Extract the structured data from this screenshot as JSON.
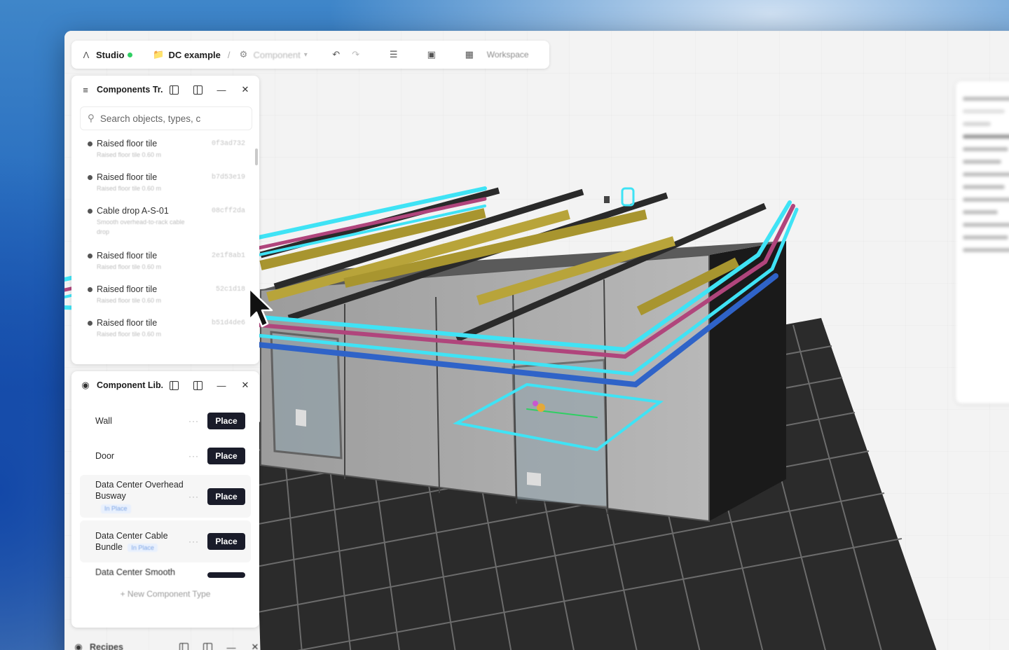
{
  "toolbar": {
    "app_name": "Studio",
    "project": "DC example",
    "component_menu": "Component",
    "workspace": "Workspace",
    "status_color": "#2fcf63"
  },
  "tree_panel": {
    "title": "Components Tr...",
    "search_placeholder": "Search objects, types, c",
    "items": [
      {
        "name": "Raised floor tile",
        "sub": "Raised floor tile 0.60 m",
        "id": "0f3ad732"
      },
      {
        "name": "Raised floor tile",
        "sub": "Raised floor tile 0.60 m",
        "id": "b7d53e19"
      },
      {
        "name": "Cable drop A-S-01",
        "sub": "Smooth overhead-to-rack cable drop",
        "id": "08cff2da"
      },
      {
        "name": "Raised floor tile",
        "sub": "Raised floor tile 0.60 m",
        "id": "2e1f8ab1"
      },
      {
        "name": "Raised floor tile",
        "sub": "Raised floor tile 0.60 m",
        "id": "52c1d18"
      },
      {
        "name": "Raised floor tile",
        "sub": "Raised floor tile 0.60 m",
        "id": "b51d4de6"
      }
    ]
  },
  "library_panel": {
    "title": "Component Lib...",
    "items": [
      {
        "name": "Wall",
        "tag": "",
        "button": "Place"
      },
      {
        "name": "Door",
        "tag": "",
        "button": "Place"
      },
      {
        "name": "Data Center Overhead Busway",
        "tag": "In Place",
        "button": "Place"
      },
      {
        "name": "Data Center Cable Bundle",
        "tag": "In Place",
        "button": "Place"
      },
      {
        "name": "Data Center Smooth",
        "tag": "",
        "button": ""
      }
    ],
    "new_type": "+ New Component Type"
  },
  "recipes_panel": {
    "title": "Recipes"
  },
  "colors": {
    "cable_cyan": "#3fe3f5",
    "cable_magenta": "#b0457c",
    "cable_blue": "#2f63c8",
    "tray_yellow": "#b8a43a",
    "rack_gray": "#a9a9a9",
    "place_button": "#1a1c2a"
  }
}
